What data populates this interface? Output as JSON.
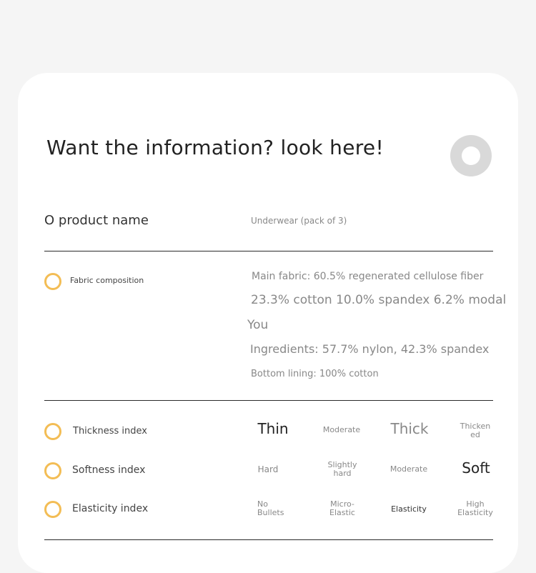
{
  "header": {
    "title": "Want the information? look here!"
  },
  "product": {
    "label": "O product name",
    "value": "Underwear (pack of 3)"
  },
  "fabric": {
    "label": "Fabric composition",
    "lines": [
      "Main fabric: 60.5% regenerated cellulose fiber",
      "23.3% cotton 10.0% spandex 6.2% modal",
      "You",
      "Ingredients: 57.7% nylon, 42.3% spandex",
      "Bottom lining: 100% cotton"
    ]
  },
  "indices": [
    {
      "label": "Thickness index",
      "levels": [
        "Thin",
        "Moderate",
        "Thick",
        "Thickened"
      ],
      "selected": "Thin"
    },
    {
      "label": "Softness index",
      "levels": [
        "Hard",
        "Slightly hard",
        "Moderate",
        "Soft"
      ],
      "selected": "Soft"
    },
    {
      "label": "Elasticity index",
      "levels": [
        "No Bullets",
        "Micro-Elastic",
        "Elasticity",
        "High Elasticity"
      ],
      "selected": "Elasticity"
    }
  ],
  "colors": {
    "accent_ring": "#f3bd55",
    "header_ring": "#d9d9d9"
  }
}
